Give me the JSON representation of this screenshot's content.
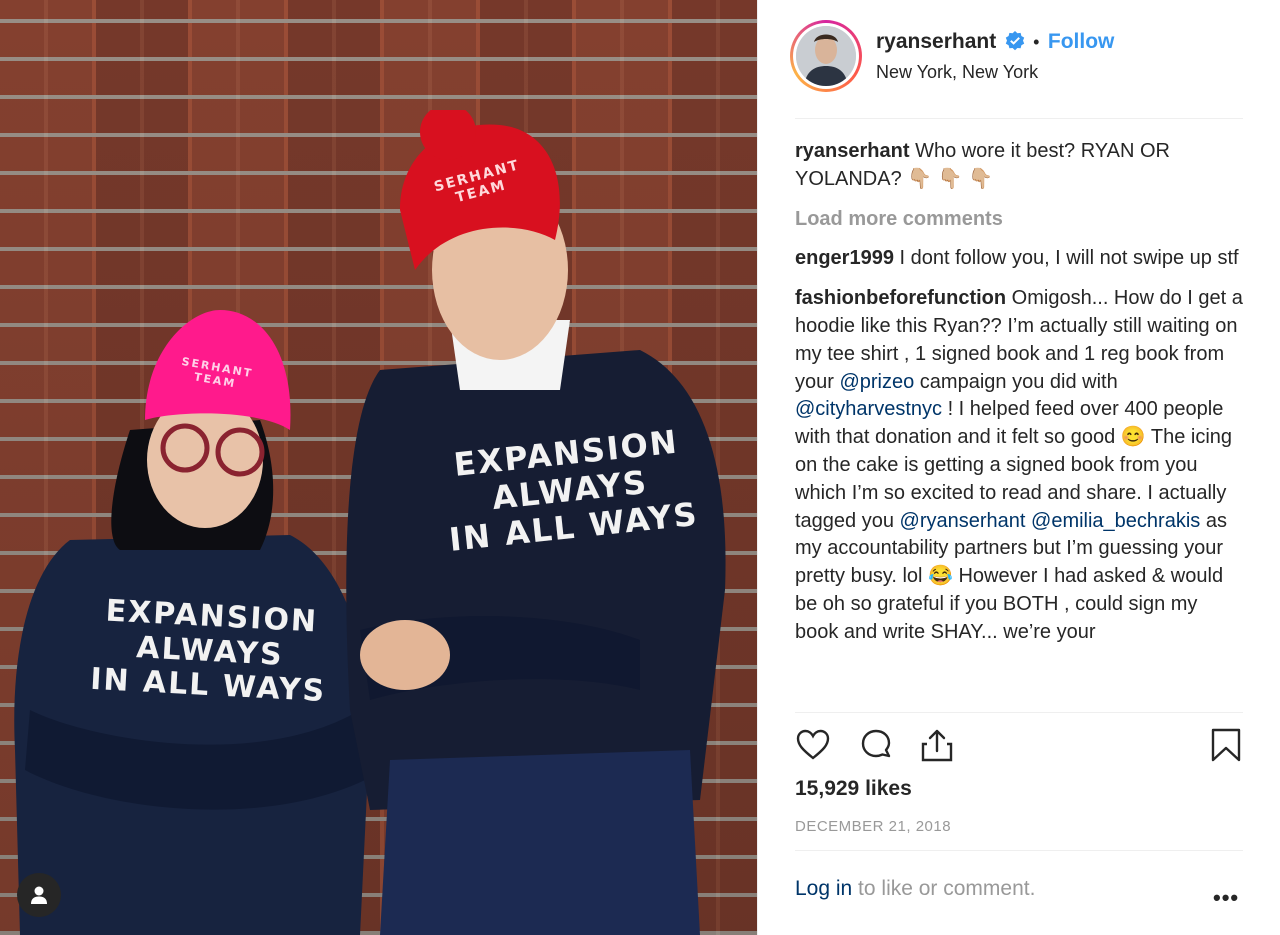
{
  "post": {
    "username": "ryanserhant",
    "follow_label": "Follow",
    "location": "New York, New York",
    "verified_icon": "verified-badge-icon",
    "colors": {
      "accent": "#3897f0",
      "link": "#003569",
      "muted": "#999999"
    }
  },
  "image": {
    "left_beanie": "SERHANT\nTEAM",
    "right_beanie": "SERHANT\nTEAM",
    "left_sweater": "EXPANSION\nALWAYS\nIN ALL WAYS",
    "right_sweater": "EXPANSION\nALWAYS\nIN ALL WAYS"
  },
  "caption": {
    "user": "ryanserhant",
    "text": "Who wore it best? RYAN OR YOLANDA? 👇🏼 👇🏼 👇🏼"
  },
  "load_more": "Load more comments",
  "comments": [
    {
      "user": "enger1999",
      "text": "I dont follow you, I will not swipe up stf"
    },
    {
      "user": "fashionbeforefunction",
      "parts": [
        "Omigosh... How do I get a hoodie like this Ryan?? I’m actually still waiting on my tee shirt , 1 signed book and 1 reg book from your ",
        "@prizeo",
        " campaign you did with ",
        "@cityharvestnyc",
        " ! I helped feed over 400 people with that donation and it felt so good 😊  The icing on the cake is getting a signed book from you which I’m so excited to read and share. I actually tagged you ",
        "@ryanserhant",
        " ",
        "@emilia_bechrakis",
        " as my accountability partners but I’m guessing your pretty busy. lol 😂  However I had asked & would be oh so grateful if you BOTH , could sign my book and write SHAY... we’re your"
      ]
    }
  ],
  "actions": {
    "like_icon": "heart-icon",
    "comment_icon": "comment-icon",
    "share_icon": "share-icon",
    "save_icon": "bookmark-icon"
  },
  "likes": "15,929 likes",
  "date": "DECEMBER 21, 2018",
  "footer": {
    "login_link": "Log in",
    "login_rest": " to like or comment.",
    "more_label": "•••"
  }
}
